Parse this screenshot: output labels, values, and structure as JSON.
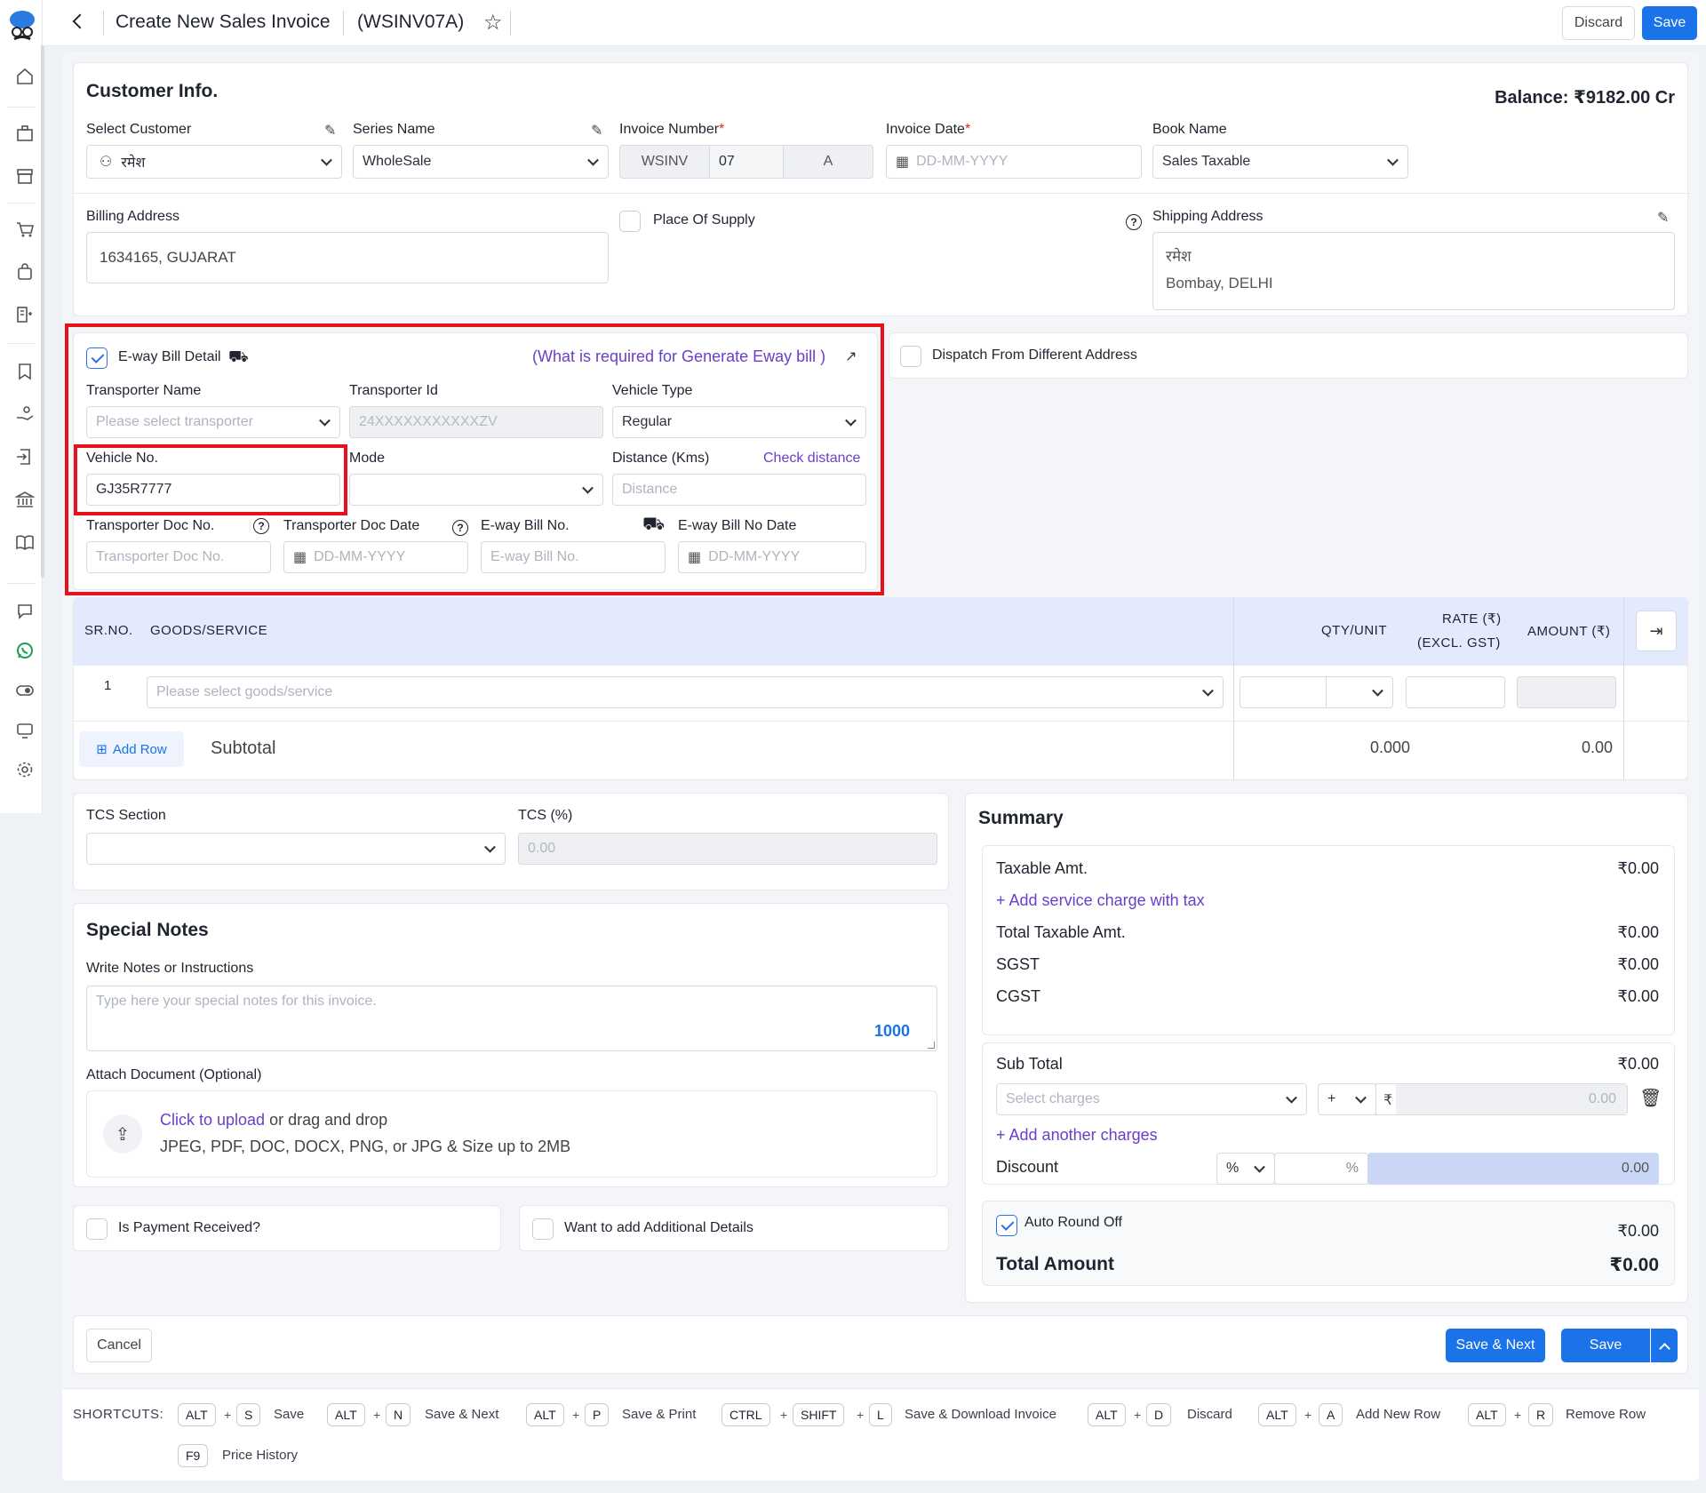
{
  "header": {
    "title": "Create New Sales Invoice",
    "code": "(WSINV07A)",
    "discard": "Discard",
    "save": "Save"
  },
  "customer": {
    "section_title": "Customer Info.",
    "balance": "Balance: ₹9182.00 Cr",
    "select_customer_label": "Select Customer",
    "customer_value": "रमेश",
    "series_label": "Series Name",
    "series_value": "WholeSale",
    "invoice_number_label": "Invoice Number",
    "invoice_prefix": "WSINV",
    "invoice_num": "07",
    "invoice_suffix": "A",
    "invoice_date_label": "Invoice Date",
    "date_placeholder": "DD-MM-YYYY",
    "book_label": "Book Name",
    "book_value": "Sales Taxable",
    "required_mark": "*"
  },
  "address": {
    "billing_label": "Billing Address",
    "billing_value": "1634165, GUJARAT",
    "place_of_supply": "Place Of Supply",
    "shipping_label": "Shipping Address",
    "shipping_name": "रमेश",
    "shipping_value": "Bombay, DELHI"
  },
  "eway": {
    "title": "E-way Bill Detail",
    "help_link": "(What is required for Generate Eway bill )",
    "dispatch_label": "Dispatch From Different Address",
    "transporter_name_label": "Transporter Name",
    "transporter_name_placeholder": "Please select transporter",
    "transporter_id_label": "Transporter Id",
    "transporter_id_placeholder": "24XXXXXXXXXXXZV",
    "vehicle_type_label": "Vehicle Type",
    "vehicle_type_value": "Regular",
    "vehicle_no_label": "Vehicle No.",
    "vehicle_no_value": "GJ35R7777",
    "mode_label": "Mode",
    "distance_label": "Distance (Kms)",
    "check_distance": "Check distance",
    "distance_placeholder": "Distance",
    "doc_no_label": "Transporter Doc No.",
    "doc_no_placeholder": "Transporter Doc No.",
    "doc_date_label": "Transporter Doc Date",
    "date_placeholder": "DD-MM-YYYY",
    "bill_no_label": "E-way Bill No.",
    "bill_no_placeholder": "E-way Bill No.",
    "bill_date_label": "E-way Bill No Date"
  },
  "items": {
    "col_srno": "SR.NO.",
    "col_goods": "GOODS/SERVICE",
    "col_qty": "QTY/UNIT",
    "col_rate_1": "RATE (₹)",
    "col_rate_2": "(EXCL. GST)",
    "col_amount": "AMOUNT (₹)",
    "row_no": "1",
    "goods_placeholder": "Please select goods/service",
    "add_row": "Add Row",
    "subtotal_label": "Subtotal",
    "subtotal_qty": "0.000",
    "subtotal_amount": "0.00"
  },
  "tcs": {
    "section_label": "TCS Section",
    "percent_label": "TCS (%)",
    "percent_value": "0.00"
  },
  "notes": {
    "title": "Special Notes",
    "label": "Write Notes or Instructions",
    "placeholder": "Type here your special notes for this invoice.",
    "counter": "1000",
    "attach_label": "Attach Document (Optional)",
    "upload_link": "Click to upload",
    "upload_rest": " or drag and drop",
    "upload_hint": "JPEG, PDF, DOC, DOCX, PNG, or JPG & Size up to 2MB"
  },
  "options": {
    "payment_received": "Is Payment Received?",
    "additional_details": "Want to add Additional Details"
  },
  "summary": {
    "title": "Summary",
    "taxable_label": "Taxable Amt.",
    "taxable_value": "₹0.00",
    "add_service": "Add service charge with tax",
    "total_taxable_label": "Total Taxable Amt.",
    "total_taxable_value": "₹0.00",
    "sgst_label": "SGST",
    "sgst_value": "₹0.00",
    "cgst_label": "CGST",
    "cgst_value": "₹0.00",
    "subtotal_label": "Sub Total",
    "subtotal_value": "₹0.00",
    "charges_placeholder": "Select charges",
    "charge_sign": "+",
    "currency": "₹",
    "charge_value": "0.00",
    "add_charges": "Add another charges",
    "discount_label": "Discount",
    "discount_type": "%",
    "discount_pct_suffix": "%",
    "discount_value": "0.00",
    "round_off_label": "Auto Round Off",
    "round_off_value": "₹0.00",
    "total_label": "Total Amount",
    "total_value": "₹0.00"
  },
  "footer": {
    "cancel": "Cancel",
    "save_next": "Save & Next",
    "save": "Save"
  },
  "shortcuts": {
    "label": "SHORTCUTS:",
    "items": [
      {
        "k1": "ALT",
        "k2": "S",
        "text": "Save"
      },
      {
        "k1": "ALT",
        "k2": "N",
        "text": "Save & Next"
      },
      {
        "k1": "ALT",
        "k2": "P",
        "text": "Save & Print"
      },
      {
        "k1": "CTRL",
        "k2": "SHIFT",
        "k3": "L",
        "text": "Save & Download Invoice"
      },
      {
        "k1": "ALT",
        "k2": "D",
        "text": "Discard"
      },
      {
        "k1": "ALT",
        "k2": "A",
        "text": "Add New Row"
      },
      {
        "k1": "ALT",
        "k2": "R",
        "text": "Remove Row"
      },
      {
        "k1": "F9",
        "text": "Price History"
      }
    ]
  },
  "colors": {
    "primary": "#1a73e8",
    "purple_link": "#6a3fc8",
    "highlight_red": "#e8101a",
    "table_header": "#e3eafd"
  }
}
